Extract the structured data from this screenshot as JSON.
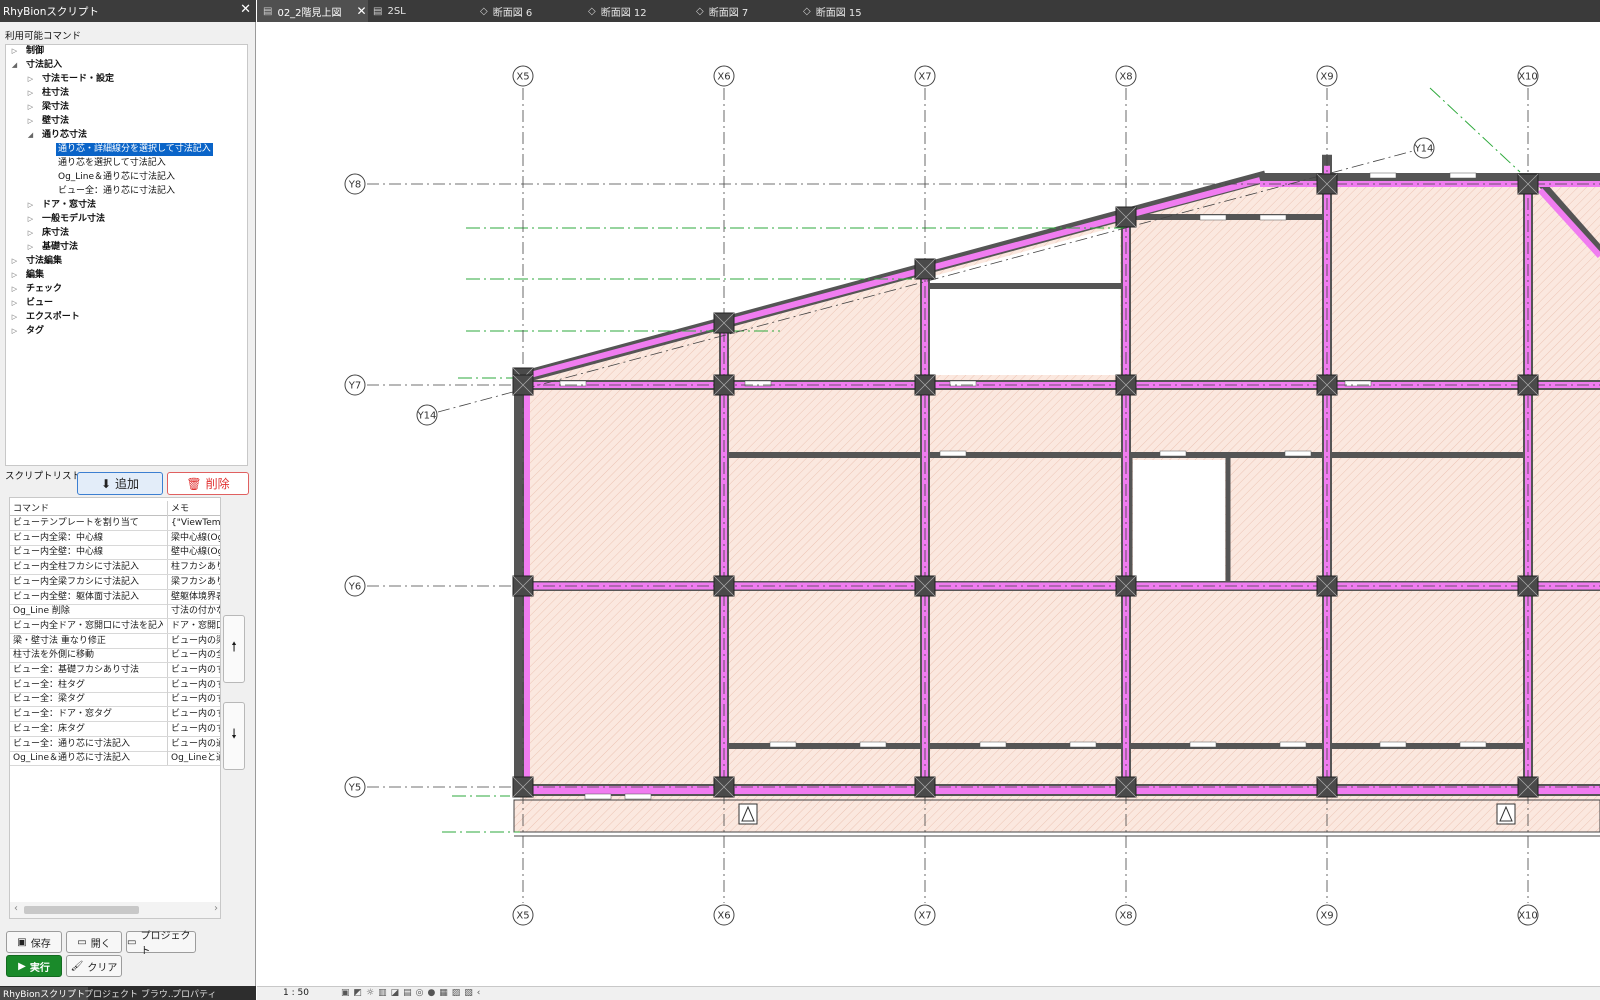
{
  "panel": {
    "title": "RhyBionスクリプト",
    "available_label": "利用可能コマンド",
    "script_list_label": "スクリプトリスト",
    "add_label": "追加",
    "delete_label": "削除",
    "save_label": "保存",
    "open_label": "開く",
    "project_label": "プロジェクト",
    "run_label": "実行",
    "clear_label": "クリア"
  },
  "tree": [
    {
      "label": "制御",
      "level": 0,
      "expanded": false,
      "bold": true,
      "selected": false
    },
    {
      "label": "寸法記入",
      "level": 0,
      "expanded": true,
      "bold": true,
      "selected": false
    },
    {
      "label": "寸法モード・設定",
      "level": 1,
      "expanded": false,
      "bold": true,
      "selected": false
    },
    {
      "label": "柱寸法",
      "level": 1,
      "expanded": false,
      "bold": true,
      "selected": false
    },
    {
      "label": "梁寸法",
      "level": 1,
      "expanded": false,
      "bold": true,
      "selected": false
    },
    {
      "label": "壁寸法",
      "level": 1,
      "expanded": false,
      "bold": true,
      "selected": false
    },
    {
      "label": "通り芯寸法",
      "level": 1,
      "expanded": true,
      "bold": true,
      "selected": false
    },
    {
      "label": "通り芯・詳細線分を選択して寸法記入",
      "level": 2,
      "leaf": true,
      "selected": true
    },
    {
      "label": "通り芯を選択して寸法記入",
      "level": 2,
      "leaf": true,
      "selected": false
    },
    {
      "label": "Og_Line＆通り芯に寸法記入",
      "level": 2,
      "leaf": true,
      "selected": false
    },
    {
      "label": "ビュー全：通り芯に寸法記入",
      "level": 2,
      "leaf": true,
      "selected": false
    },
    {
      "label": "ドア・窓寸法",
      "level": 1,
      "expanded": false,
      "bold": true,
      "selected": false
    },
    {
      "label": "一般モデル寸法",
      "level": 1,
      "expanded": false,
      "bold": true,
      "selected": false
    },
    {
      "label": "床寸法",
      "level": 1,
      "expanded": false,
      "bold": true,
      "selected": false
    },
    {
      "label": "基礎寸法",
      "level": 1,
      "expanded": false,
      "bold": true,
      "selected": false
    },
    {
      "label": "寸法編集",
      "level": 0,
      "expanded": false,
      "bold": true,
      "selected": false
    },
    {
      "label": "編集",
      "level": 0,
      "expanded": false,
      "bold": true,
      "selected": false
    },
    {
      "label": "チェック",
      "level": 0,
      "expanded": false,
      "bold": true,
      "selected": false
    },
    {
      "label": "ビュー",
      "level": 0,
      "expanded": false,
      "bold": true,
      "selected": false
    },
    {
      "label": "エクスポート",
      "level": 0,
      "expanded": false,
      "bold": true,
      "selected": false
    },
    {
      "label": "タグ",
      "level": 0,
      "expanded": false,
      "bold": true,
      "selected": false
    }
  ],
  "script_table": {
    "headers": [
      "コマンド",
      "メモ"
    ],
    "rows": [
      [
        "ビューテンプレートを割り当て",
        "{\"ViewTempla"
      ],
      [
        "ビュー内全梁：中心線",
        "梁中心線(Og"
      ],
      [
        "ビュー内全壁：中心線",
        "壁中心線(Og"
      ],
      [
        "ビュー内全柱フカシに寸法記入",
        "柱フカシあり寸"
      ],
      [
        "ビュー内全梁フカシに寸法記入",
        "梁フカシあり寸"
      ],
      [
        "ビュー内全壁：躯体面寸法記入",
        "壁躯体境界表"
      ],
      [
        "Og_Line 削除",
        "寸法の付かな"
      ],
      [
        "ビュー内全ドア・窓開口に寸法を記入",
        "ドア・窓開口に"
      ],
      [
        "梁・壁寸法 重なり修正",
        "ビュー内の梁寸"
      ],
      [
        "柱寸法を外側に移動",
        "ビュー内の全柱"
      ],
      [
        "ビュー全：基礎フカシあり寸法",
        "ビュー内のすべ"
      ],
      [
        "ビュー全：柱タグ",
        "ビュー内のすべ"
      ],
      [
        "ビュー全：梁タグ",
        "ビュー内のすべ"
      ],
      [
        "ビュー全：ドア・窓タグ",
        "ビュー内のすべ"
      ],
      [
        "ビュー全：床タグ",
        "ビュー内のすべ"
      ],
      [
        "ビュー全：通り芯に寸法記入",
        "ビュー内の通り"
      ],
      [
        "Og_Line＆通り芯に寸法記入",
        "Og_Lineと通り"
      ]
    ]
  },
  "bottom_tabs": [
    "RhyBionスクリプト",
    "プロジェクト ブラウ...",
    "プロパティ"
  ],
  "tabs": [
    {
      "label": "02_2階見上図",
      "active": true,
      "icon": "floor-plan-icon"
    },
    {
      "label": "2SL",
      "active": false,
      "icon": "floor-plan-icon"
    },
    {
      "label": "断面図 6",
      "active": false,
      "icon": "section-icon"
    },
    {
      "label": "断面図 12",
      "active": false,
      "icon": "section-icon"
    },
    {
      "label": "断面図 7",
      "active": false,
      "icon": "section-icon"
    },
    {
      "label": "断面図 15",
      "active": false,
      "icon": "section-icon"
    }
  ],
  "drawing": {
    "x_grids": [
      "X5",
      "X6",
      "X7",
      "X8",
      "X9",
      "X10"
    ],
    "y_grids": [
      "Y8",
      "Y7",
      "Y6",
      "Y5"
    ],
    "diag_grid": "Y14",
    "colors": {
      "beam": "#f07cf0",
      "wall": "#555555",
      "hatch": "#f6d8cc",
      "dim": "#2eaa3c"
    }
  },
  "status": {
    "scale": "1 : 50"
  }
}
